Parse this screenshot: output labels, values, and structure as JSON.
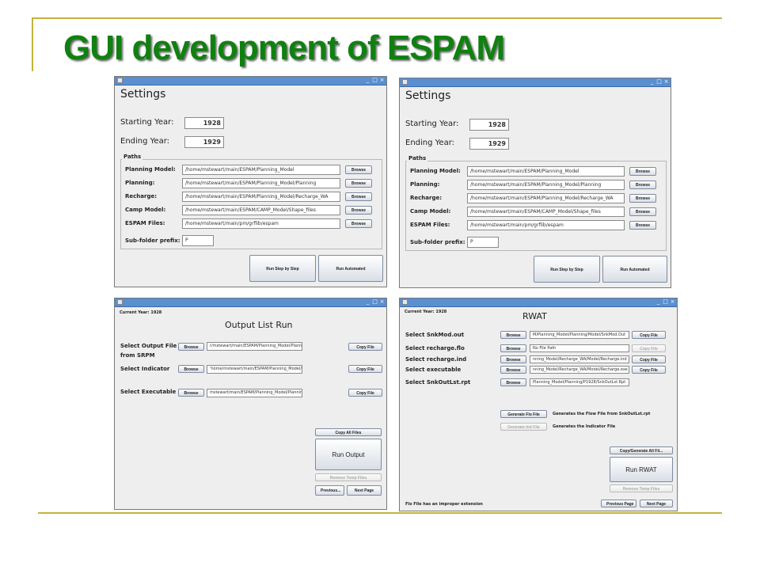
{
  "slide": {
    "title": "GUI development of ESPAM"
  },
  "window_controls": {
    "min": "_",
    "max": "□",
    "close": "×"
  },
  "settings": {
    "heading": "Settings",
    "starting_year_label": "Starting Year:",
    "starting_year": "1928",
    "ending_year_label": "Ending Year:",
    "ending_year": "1929",
    "paths_label": "Paths",
    "rows": [
      {
        "label": "Planning Model:",
        "value": "/home/mstewart/main/ESPAM/Planning_Model"
      },
      {
        "label": "Planning:",
        "value": "/home/mstewart/main/ESPAM/Planning_Model/Planning"
      },
      {
        "label": "Recharge:",
        "value": "/home/mstewart/main/ESPAM/Planning_Model/Recharge_WA"
      },
      {
        "label": "Camp Model:",
        "value": "/home/mstewart/main/ESPAM/CAMP_Model/Shape_files"
      },
      {
        "label": "ESPAM Files:",
        "value": "/home/mstewart/main/pm/grflib/espam"
      }
    ],
    "browse_label": "Browse",
    "subfolder_label": "Sub-folder prefix:",
    "subfolder_value": "P",
    "run_step_label": "Run Step by Step",
    "run_automated_label": "Run Automated"
  },
  "output_list": {
    "current_year": "Current Year: 1928",
    "title": "Output List Run",
    "browse_label": "Browse",
    "copy_label": "Copy File",
    "rows": [
      {
        "label": "Select Output File",
        "label2": "from SRPM",
        "value": "r/mstewart/main/ESPAM/Planning_Model/Planning/Model/SnkMod.Out"
      },
      {
        "label": "Select Indicator",
        "value": "'home/mstewart/main/ESPAM/Planning_Model/Planning/SnkOutLst.ind"
      },
      {
        "label": "Select Executable",
        "value": "mstewart/main/ESPAM/Planning_Model/Planning/Model/SnkOutLst.exe"
      }
    ],
    "copy_all_label": "Copy All Files",
    "run_output_label": "Run Output",
    "remove_temp_label": "Remove Temp Files",
    "previous_label": "Previous...",
    "next_label": "Next Page"
  },
  "rwat": {
    "current_year": "Current Year: 1928",
    "title": "RWAT",
    "browse_label": "Browse",
    "copy_label": "Copy File",
    "rows": [
      {
        "label": "Select SnkMod.out",
        "value": "M/Planning_Model/Planning/Model/SnkMod.Out",
        "copy": true,
        "copy_enabled": true
      },
      {
        "label": "Select recharge.flo",
        "value": "No File Path",
        "copy": true,
        "copy_enabled": false
      },
      {
        "label": "Select recharge.ind",
        "value": "nning_Model/Recharge_WA/Model/Recharge.ind",
        "copy": true,
        "copy_enabled": true
      },
      {
        "label": "Select executable",
        "value": "nning_Model/Recharge_WA/Model/Recharge.exe",
        "copy": true,
        "copy_enabled": true
      },
      {
        "label": "Select SnkOutLst.rpt",
        "value": "Planning_Model/Planning/P1928/SnkOutLst.Rpt",
        "copy": false,
        "copy_enabled": false
      }
    ],
    "gen_flo_label": "Generate Flo File",
    "gen_flo_desc": "Generates the Flow File from SnkOutLst.rpt",
    "gen_ind_label": "Generate Ind File",
    "gen_ind_desc": "Generates the Indicator File",
    "copy_generate_label": "Copy/Generate All Fil...",
    "run_rwat_label": "Run RWAT",
    "remove_temp_label": "Remove Temp Files",
    "status": "Flo File has an improper extension",
    "previous_label": "Previous Page",
    "next_label": "Next Page"
  }
}
